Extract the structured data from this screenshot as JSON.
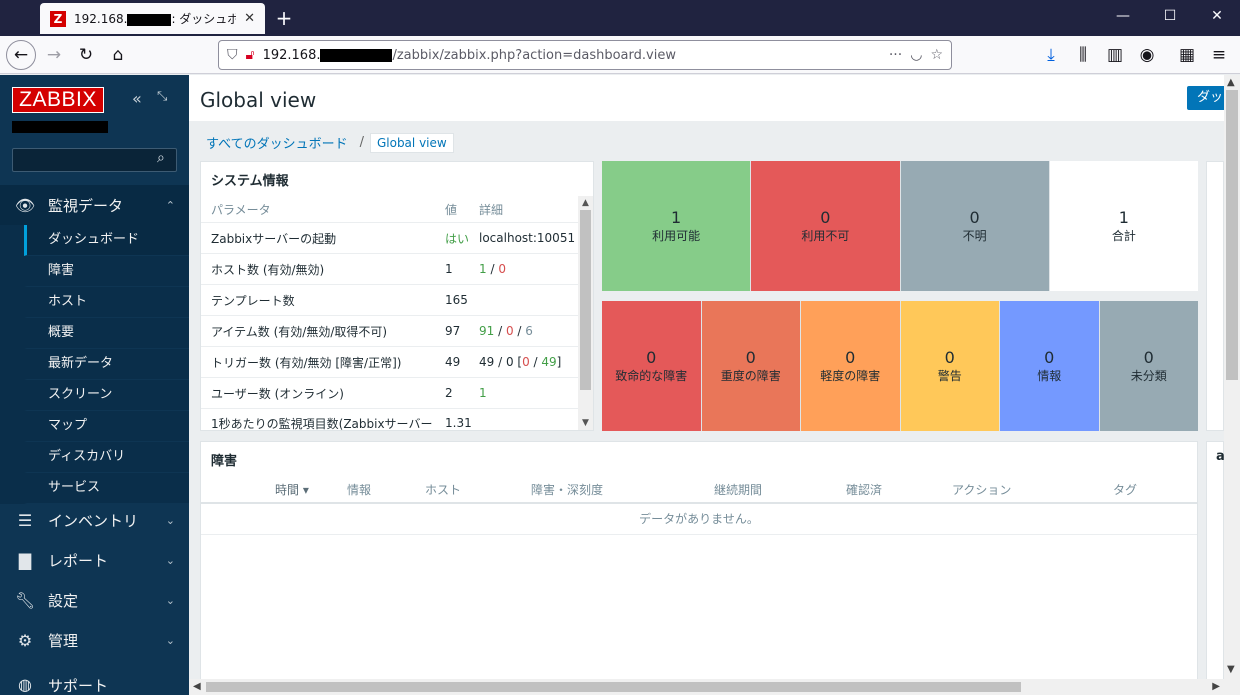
{
  "browser": {
    "tab_title_prefix": "192.168.",
    "tab_title_suffix": ": ダッシュボード",
    "url_prefix": "192.168.",
    "url_suffix": "/zabbix/zabbix.php?action=dashboard.view"
  },
  "sidebar": {
    "logo": "ZABBIX",
    "menu": [
      {
        "label": "監視データ",
        "icon": "eye-icon"
      },
      {
        "label": "インベントリ",
        "icon": "list-icon"
      },
      {
        "label": "レポート",
        "icon": "bar-chart-icon"
      },
      {
        "label": "設定",
        "icon": "wrench-icon"
      },
      {
        "label": "管理",
        "icon": "gear-icon"
      },
      {
        "label": "サポート",
        "icon": "support-icon"
      }
    ],
    "submenu": [
      "ダッシュボード",
      "障害",
      "ホスト",
      "概要",
      "最新データ",
      "スクリーン",
      "マップ",
      "ディスカバリ",
      "サービス"
    ]
  },
  "header": {
    "title": "Global view",
    "dash_button": "ダッ"
  },
  "breadcrumbs": {
    "all": "すべてのダッシュボード",
    "sep": "/",
    "current": "Global view"
  },
  "system_info": {
    "title": "システム情報",
    "columns": [
      "パラメータ",
      "値",
      "詳細"
    ],
    "rows": [
      {
        "param": "Zabbixサーバーの起動",
        "value": "はい",
        "detail": "localhost:10051"
      },
      {
        "param": "ホスト数 (有効/無効)",
        "value": "1",
        "d1": "1",
        "d2": "0"
      },
      {
        "param": "テンプレート数",
        "value": "165"
      },
      {
        "param": "アイテム数 (有効/無効/取得不可)",
        "value": "97",
        "d1": "91",
        "d2": "0",
        "d3": "6"
      },
      {
        "param": "トリガー数 (有効/無効 [障害/正常])",
        "value": "49",
        "d_prefix": "49 / 0 [",
        "d1": "0",
        "d2": "49",
        "d_suffix": "]"
      },
      {
        "param": "ユーザー数 (オンライン)",
        "value": "2",
        "d1": "1"
      },
      {
        "param": "1秒あたりの監視項目数(Zabbixサーバー",
        "value": "1.31"
      }
    ]
  },
  "host_availability": [
    {
      "count": "1",
      "label": "利用可能",
      "color": "#86cc89"
    },
    {
      "count": "0",
      "label": "利用不可",
      "color": "#e45959"
    },
    {
      "count": "0",
      "label": "不明",
      "color": "#97aab3"
    },
    {
      "count": "1",
      "label": "合計",
      "color": "#ffffff"
    }
  ],
  "severities": [
    {
      "count": "0",
      "label": "致命的な障害",
      "color": "#e45959"
    },
    {
      "count": "0",
      "label": "重度の障害",
      "color": "#e97659"
    },
    {
      "count": "0",
      "label": "軽度の障害",
      "color": "#ffa059"
    },
    {
      "count": "0",
      "label": "警告",
      "color": "#ffc859"
    },
    {
      "count": "0",
      "label": "情報",
      "color": "#7499ff"
    },
    {
      "count": "0",
      "label": "未分類",
      "color": "#97aab3"
    }
  ],
  "problems": {
    "title": "障害",
    "columns": [
      "時間 ▾",
      "情報",
      "ホスト",
      "障害・深刻度",
      "継続期間",
      "確認済",
      "アクション",
      "タグ"
    ],
    "empty": "データがありません。"
  },
  "right_widget": {
    "title_fragment": "a"
  }
}
